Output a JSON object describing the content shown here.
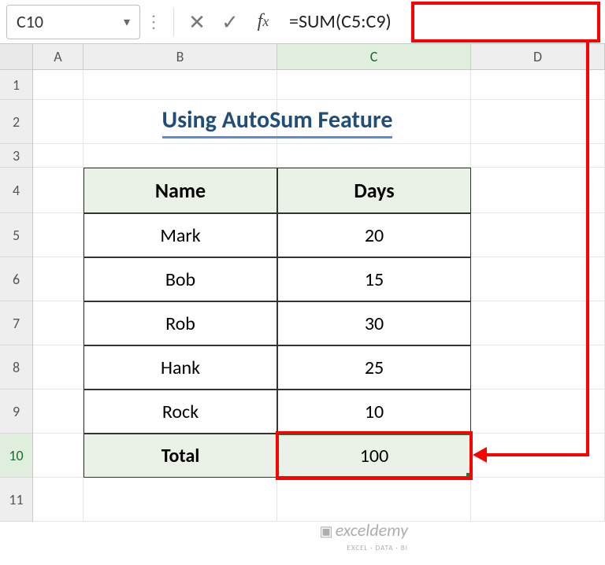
{
  "name_box": "C10",
  "formula": "=SUM(C5:C9)",
  "cols": {
    "A": "A",
    "B": "B",
    "C": "C",
    "D": "D"
  },
  "rows": {
    "r1": "1",
    "r2": "2",
    "r3": "3",
    "r4": "4",
    "r5": "5",
    "r6": "6",
    "r7": "7",
    "r8": "8",
    "r9": "9",
    "r10": "10",
    "r11": "11"
  },
  "title": "Using AutoSum Feature",
  "table": {
    "header": {
      "name": "Name",
      "days": "Days"
    },
    "rows": [
      {
        "name": "Mark",
        "days": "20"
      },
      {
        "name": "Bob",
        "days": "15"
      },
      {
        "name": "Rob",
        "days": "30"
      },
      {
        "name": "Hank",
        "days": "25"
      },
      {
        "name": "Rock",
        "days": "10"
      }
    ],
    "total": {
      "label": "Total",
      "value": "100"
    }
  },
  "watermark": {
    "brand": "exceldemy",
    "tagline": "EXCEL · DATA · BI"
  },
  "chart_data": {
    "type": "table",
    "title": "Using AutoSum Feature",
    "columns": [
      "Name",
      "Days"
    ],
    "rows": [
      [
        "Mark",
        20
      ],
      [
        "Bob",
        15
      ],
      [
        "Rob",
        30
      ],
      [
        "Hank",
        25
      ],
      [
        "Rock",
        10
      ]
    ],
    "total": 100,
    "formula": "=SUM(C5:C9)"
  }
}
